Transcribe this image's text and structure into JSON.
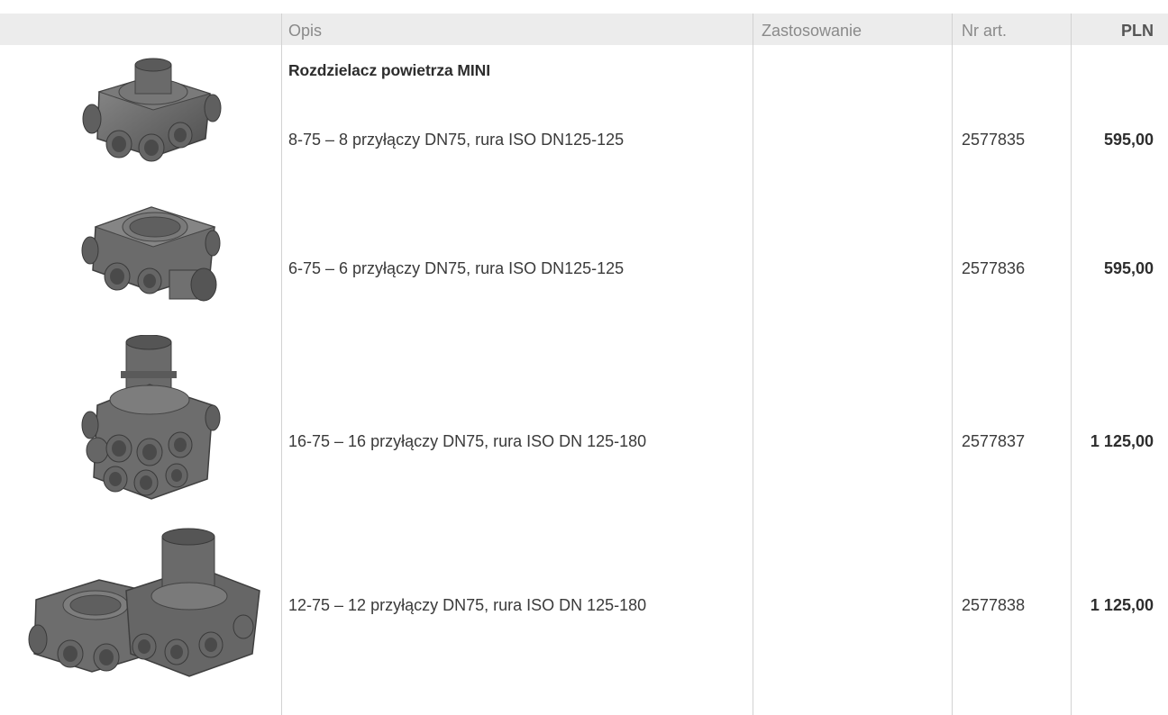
{
  "table": {
    "headers": {
      "opis": "Opis",
      "zastosowanie": "Zastosowanie",
      "nr_art": "Nr art.",
      "pln": "PLN"
    },
    "group_title": "Rozdzielacz powietrza MINI",
    "rows": [
      {
        "opis": "8-75 – 8 przyłączy DN75, rura ISO DN125-125",
        "nr_art": "2577835",
        "price": "595,00",
        "image": "air-distributor-8-ports"
      },
      {
        "opis": "6-75 – 6 przyłączy DN75, rura ISO DN125-125",
        "nr_art": "2577836",
        "price": "595,00",
        "image": "air-distributor-6-ports"
      },
      {
        "opis": "16-75 – 16 przyłączy DN75, rura ISO DN 125-180",
        "nr_art": "2577837",
        "price": "1 125,00",
        "image": "air-distributor-16-ports"
      },
      {
        "opis": "12-75 – 12 przyłączy DN75, rura ISO DN 125-180",
        "nr_art": "2577838",
        "price": "1 125,00",
        "image": "air-distributor-12-ports"
      }
    ]
  },
  "colors": {
    "header_bg": "#ececec",
    "divider": "#d2d2d2",
    "product_gray": "#6f6f6f"
  }
}
